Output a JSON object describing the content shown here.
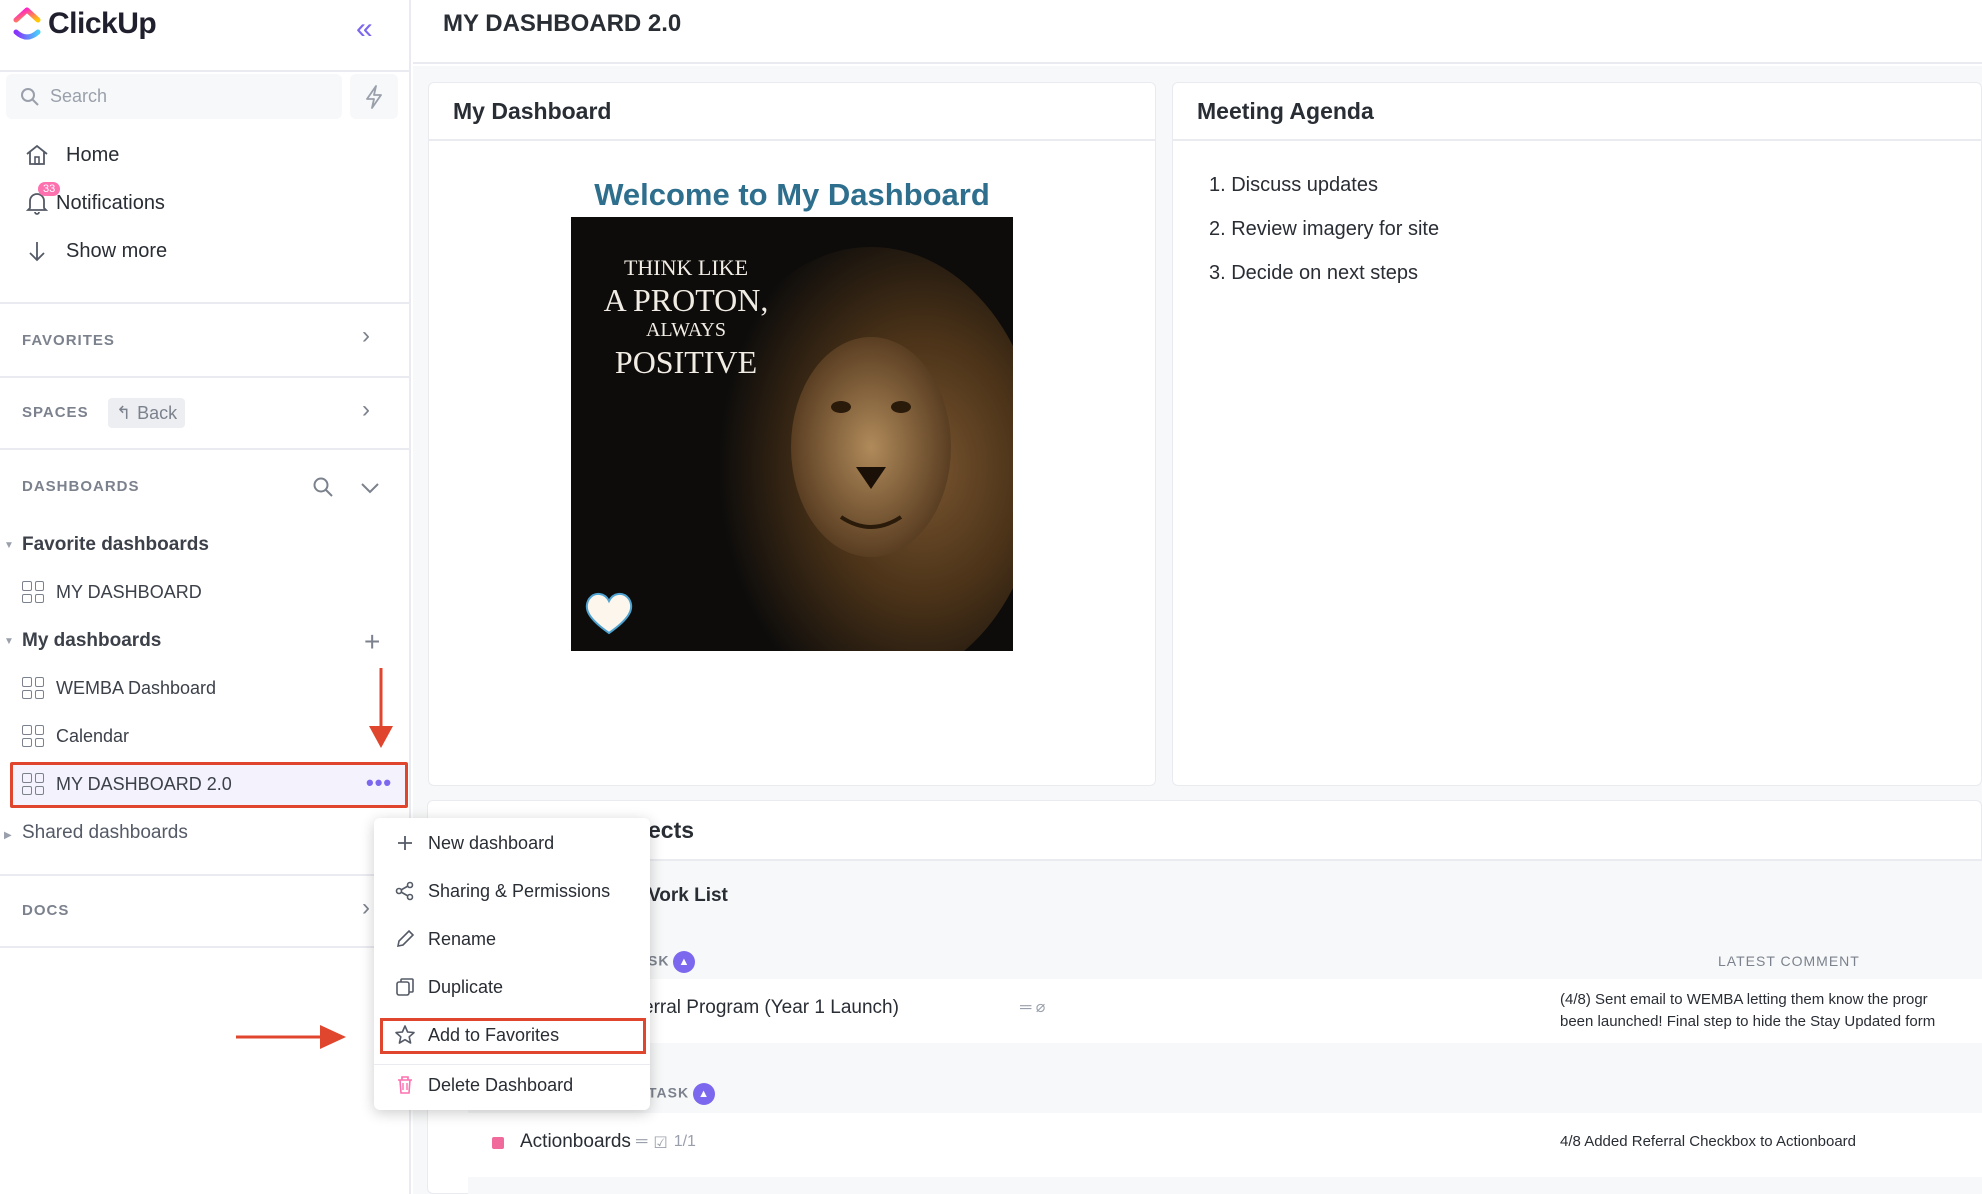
{
  "app": {
    "name": "ClickUp"
  },
  "sidebar": {
    "search_placeholder": "Search",
    "nav": [
      {
        "label": "Home"
      },
      {
        "label": "Notifications",
        "badge": "33"
      },
      {
        "label": "Show more"
      }
    ],
    "sections": {
      "favorites": "FAVORITES",
      "spaces": "SPACES",
      "spaces_back": "Back",
      "dashboards": "DASHBOARDS",
      "docs": "DOCS"
    },
    "groups": {
      "favorite_dashboards": "Favorite dashboards",
      "my_dashboards": "My dashboards",
      "shared_dashboards": "Shared dashboards"
    },
    "favorite_items": [
      "MY DASHBOARD"
    ],
    "my_items": [
      "WEMBA Dashboard",
      "Calendar",
      "MY DASHBOARD 2.0"
    ]
  },
  "page": {
    "title": "MY DASHBOARD 2.0"
  },
  "cards": {
    "my_dashboard": {
      "title": "My Dashboard",
      "welcome": "Welcome to My Dashboard",
      "poster": [
        "THINK LIKE",
        "A PROTON,",
        "ALWAYS",
        "POSITIVE"
      ]
    },
    "agenda": {
      "title": "Meeting Agenda",
      "items": [
        "1. Discuss updates",
        "2. Review imagery for site",
        "3. Decide on next steps"
      ]
    },
    "projects": {
      "title_fragment": "ects",
      "list_fragment": "Vork List",
      "col_task": "SK",
      "col_task2": "TASK",
      "col_comment": "LATEST COMMENT",
      "rows": [
        {
          "task": "erral Program (Year 1 Launch)",
          "comment": "(4/8) Sent email to WEMBA letting them know the progr",
          "comment2": "been launched! Final step to hide the Stay Updated form"
        },
        {
          "task": "Actionboards",
          "checklist": "1/1",
          "comment": "4/8 Added Referral Checkbox to Actionboard"
        }
      ]
    }
  },
  "context_menu": {
    "items": [
      "New dashboard",
      "Sharing & Permissions",
      "Rename",
      "Duplicate",
      "Add to Favorites",
      "Delete Dashboard"
    ]
  },
  "colors": {
    "accent": "#7b68ee",
    "highlight": "#e0452e",
    "title_blue": "#2e6f8e"
  }
}
